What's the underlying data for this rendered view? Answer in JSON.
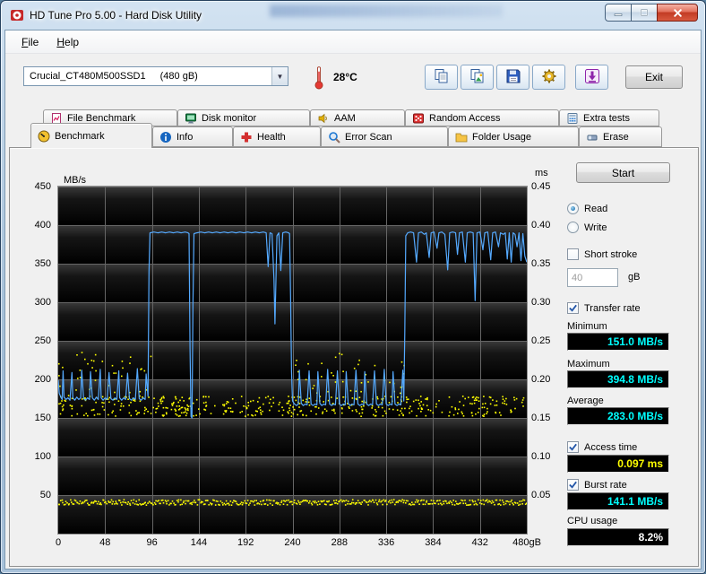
{
  "window": {
    "title": "HD Tune Pro 5.00 - Hard Disk Utility"
  },
  "menu": {
    "items": [
      {
        "label": "File"
      },
      {
        "label": "Help"
      }
    ]
  },
  "toolbar": {
    "drive_name": "Crucial_CT480M500SSD1",
    "drive_size": "(480 gB)",
    "temperature": "28°C",
    "exit_label": "Exit"
  },
  "tabs": {
    "row1": [
      {
        "label": "File Benchmark"
      },
      {
        "label": "Disk monitor"
      },
      {
        "label": "AAM"
      },
      {
        "label": "Random Access"
      },
      {
        "label": "Extra tests"
      }
    ],
    "row2": [
      {
        "label": "Benchmark",
        "active": true
      },
      {
        "label": "Info"
      },
      {
        "label": "Health"
      },
      {
        "label": "Error Scan"
      },
      {
        "label": "Folder Usage"
      },
      {
        "label": "Erase"
      }
    ]
  },
  "panel": {
    "start_label": "Start",
    "read_label": "Read",
    "write_label": "Write",
    "short_stroke_label": "Short stroke",
    "short_stroke_value": "40",
    "short_stroke_unit": "gB",
    "transfer_rate_label": "Transfer rate",
    "minimum_label": "Minimum",
    "minimum_value": "151.0 MB/s",
    "maximum_label": "Maximum",
    "maximum_value": "394.8 MB/s",
    "average_label": "Average",
    "average_value": "283.0 MB/s",
    "access_time_label": "Access time",
    "access_time_value": "0.097 ms",
    "burst_rate_label": "Burst rate",
    "burst_rate_value": "141.1 MB/s",
    "cpu_usage_label": "CPU usage",
    "cpu_usage_value": "8.2%"
  },
  "chart_data": {
    "type": "line",
    "title": "Read benchmark: transfer rate (line) and access time (dots)",
    "x_axis": {
      "range": [
        0,
        480
      ],
      "ticks": [
        0,
        48,
        96,
        144,
        192,
        240,
        288,
        336,
        384,
        432,
        480
      ],
      "tick_labels": [
        "0",
        "48",
        "96",
        "144",
        "192",
        "240",
        "288",
        "336",
        "384",
        "432",
        "480gB"
      ]
    },
    "y_left": {
      "label": "MB/s",
      "range": [
        0,
        450
      ],
      "ticks": [
        450,
        400,
        350,
        300,
        250,
        200,
        150,
        100,
        50
      ]
    },
    "y_right": {
      "label": "ms",
      "range": [
        0,
        0.45
      ],
      "tick_labels": [
        "0.45",
        "0.40",
        "0.35",
        "0.30",
        "0.25",
        "0.20",
        "0.15",
        "0.10",
        "0.05"
      ]
    },
    "grid": true,
    "grid_color": "#666666",
    "plot_bg": "#000000",
    "series": [
      {
        "name": "Transfer rate",
        "unit": "MB/s",
        "color": "#55aaff",
        "type": "line",
        "points": [
          [
            0,
            199
          ],
          [
            1,
            182
          ],
          [
            3,
            176
          ],
          [
            4,
            174
          ],
          [
            5,
            211
          ],
          [
            6,
            177
          ],
          [
            8,
            174
          ],
          [
            10,
            176
          ],
          [
            12,
            173
          ],
          [
            14,
            209
          ],
          [
            15,
            176
          ],
          [
            17,
            173
          ],
          [
            19,
            177
          ],
          [
            21,
            174
          ],
          [
            23,
            176
          ],
          [
            24,
            212
          ],
          [
            26,
            175
          ],
          [
            28,
            173
          ],
          [
            30,
            176
          ],
          [
            32,
            174
          ],
          [
            33,
            210
          ],
          [
            35,
            176
          ],
          [
            37,
            173
          ],
          [
            39,
            177
          ],
          [
            41,
            174
          ],
          [
            43,
            213
          ],
          [
            44,
            176
          ],
          [
            46,
            173
          ],
          [
            48,
            176
          ],
          [
            50,
            174
          ],
          [
            52,
            209
          ],
          [
            54,
            175
          ],
          [
            56,
            173
          ],
          [
            58,
            176
          ],
          [
            60,
            174
          ],
          [
            62,
            211
          ],
          [
            63,
            176
          ],
          [
            65,
            173
          ],
          [
            67,
            176
          ],
          [
            69,
            174
          ],
          [
            71,
            208
          ],
          [
            73,
            175
          ],
          [
            75,
            173
          ],
          [
            77,
            176
          ],
          [
            79,
            174
          ],
          [
            81,
            214
          ],
          [
            83,
            175
          ],
          [
            85,
            173
          ],
          [
            87,
            176
          ],
          [
            89,
            174
          ],
          [
            90,
            207
          ],
          [
            92,
            178
          ],
          [
            93,
            340
          ],
          [
            94,
            390
          ],
          [
            98,
            391
          ],
          [
            102,
            390
          ],
          [
            106,
            391
          ],
          [
            110,
            390
          ],
          [
            114,
            391
          ],
          [
            118,
            390
          ],
          [
            122,
            391
          ],
          [
            126,
            390
          ],
          [
            130,
            391
          ],
          [
            133,
            390
          ],
          [
            134,
            389
          ],
          [
            135,
            240
          ],
          [
            136,
            152
          ],
          [
            137,
            150
          ],
          [
            138,
            300
          ],
          [
            139,
            389
          ],
          [
            142,
            390
          ],
          [
            146,
            391
          ],
          [
            150,
            390
          ],
          [
            154,
            391
          ],
          [
            158,
            390
          ],
          [
            162,
            391
          ],
          [
            166,
            390
          ],
          [
            170,
            391
          ],
          [
            174,
            390
          ],
          [
            178,
            391
          ],
          [
            182,
            390
          ],
          [
            186,
            391
          ],
          [
            190,
            390
          ],
          [
            194,
            391
          ],
          [
            198,
            390
          ],
          [
            202,
            391
          ],
          [
            206,
            390
          ],
          [
            210,
            391
          ],
          [
            213,
            390
          ],
          [
            215,
            346
          ],
          [
            217,
            390
          ],
          [
            219,
            389
          ],
          [
            221,
            330
          ],
          [
            222,
            272
          ],
          [
            224,
            386
          ],
          [
            226,
            390
          ],
          [
            228,
            341
          ],
          [
            230,
            390
          ],
          [
            233,
            391
          ],
          [
            236,
            390
          ],
          [
            237,
            389
          ],
          [
            238,
            310
          ],
          [
            239,
            210
          ],
          [
            240,
            172
          ],
          [
            242,
            168
          ],
          [
            244,
            166
          ],
          [
            246,
            168
          ],
          [
            247,
            212
          ],
          [
            249,
            169
          ],
          [
            251,
            166
          ],
          [
            253,
            168
          ],
          [
            255,
            167
          ],
          [
            257,
            211
          ],
          [
            259,
            168
          ],
          [
            261,
            166
          ],
          [
            263,
            168
          ],
          [
            265,
            167
          ],
          [
            266,
            210
          ],
          [
            268,
            169
          ],
          [
            270,
            166
          ],
          [
            272,
            168
          ],
          [
            274,
            167
          ],
          [
            276,
            213
          ],
          [
            278,
            168
          ],
          [
            280,
            166
          ],
          [
            282,
            168
          ],
          [
            284,
            167
          ],
          [
            286,
            211
          ],
          [
            288,
            168
          ],
          [
            290,
            166
          ],
          [
            292,
            168
          ],
          [
            294,
            167
          ],
          [
            295,
            210
          ],
          [
            297,
            169
          ],
          [
            299,
            166
          ],
          [
            301,
            168
          ],
          [
            303,
            167
          ],
          [
            305,
            212
          ],
          [
            307,
            168
          ],
          [
            309,
            166
          ],
          [
            311,
            168
          ],
          [
            313,
            167
          ],
          [
            314,
            210
          ],
          [
            316,
            168
          ],
          [
            318,
            166
          ],
          [
            320,
            168
          ],
          [
            322,
            167
          ],
          [
            324,
            211
          ],
          [
            326,
            168
          ],
          [
            328,
            166
          ],
          [
            330,
            168
          ],
          [
            332,
            167
          ],
          [
            334,
            213
          ],
          [
            336,
            168
          ],
          [
            338,
            166
          ],
          [
            340,
            168
          ],
          [
            342,
            167
          ],
          [
            343,
            210
          ],
          [
            345,
            168
          ],
          [
            347,
            166
          ],
          [
            349,
            168
          ],
          [
            351,
            167
          ],
          [
            353,
            212
          ],
          [
            354,
            172
          ],
          [
            355,
            260
          ],
          [
            356,
            386
          ],
          [
            358,
            390
          ],
          [
            361,
            391
          ],
          [
            364,
            390
          ],
          [
            367,
            352
          ],
          [
            369,
            390
          ],
          [
            372,
            391
          ],
          [
            375,
            388
          ],
          [
            377,
            390
          ],
          [
            380,
            358
          ],
          [
            382,
            390
          ],
          [
            385,
            391
          ],
          [
            388,
            370
          ],
          [
            390,
            390
          ],
          [
            393,
            391
          ],
          [
            396,
            388
          ],
          [
            399,
            342
          ],
          [
            401,
            390
          ],
          [
            404,
            391
          ],
          [
            407,
            390
          ],
          [
            409,
            362
          ],
          [
            411,
            390
          ],
          [
            414,
            391
          ],
          [
            417,
            352
          ],
          [
            419,
            390
          ],
          [
            422,
            391
          ],
          [
            425,
            390
          ],
          [
            427,
            302
          ],
          [
            429,
            390
          ],
          [
            432,
            391
          ],
          [
            435,
            368
          ],
          [
            437,
            390
          ],
          [
            440,
            391
          ],
          [
            443,
            355
          ],
          [
            445,
            390
          ],
          [
            448,
            391
          ],
          [
            451,
            372
          ],
          [
            453,
            390
          ],
          [
            456,
            388
          ],
          [
            458,
            390
          ],
          [
            460,
            356
          ],
          [
            462,
            390
          ],
          [
            464,
            352
          ],
          [
            466,
            390
          ],
          [
            468,
            388
          ],
          [
            470,
            372
          ],
          [
            472,
            390
          ],
          [
            474,
            354
          ],
          [
            476,
            389
          ],
          [
            478,
            360
          ],
          [
            480,
            352
          ]
        ]
      },
      {
        "name": "Access time",
        "unit": "ms",
        "color": "#ffff00",
        "type": "scatter",
        "dense_band_ms": [
          0.152,
          0.178
        ],
        "outlier_band_ms": [
          0.178,
          0.235
        ],
        "outlier_x_ranges": [
          [
            0,
            96
          ],
          [
            238,
            356
          ]
        ],
        "outlier_count_per_range": 40,
        "bottom_band_ms": [
          0.037,
          0.044
        ],
        "dense_count": 460
      }
    ],
    "summary": {
      "minimum": "151.0 MB/s",
      "maximum": "394.8 MB/s",
      "average": "283.0 MB/s",
      "access_time": "0.097 ms",
      "burst_rate": "141.1 MB/s",
      "cpu_usage": "8.2%"
    }
  }
}
